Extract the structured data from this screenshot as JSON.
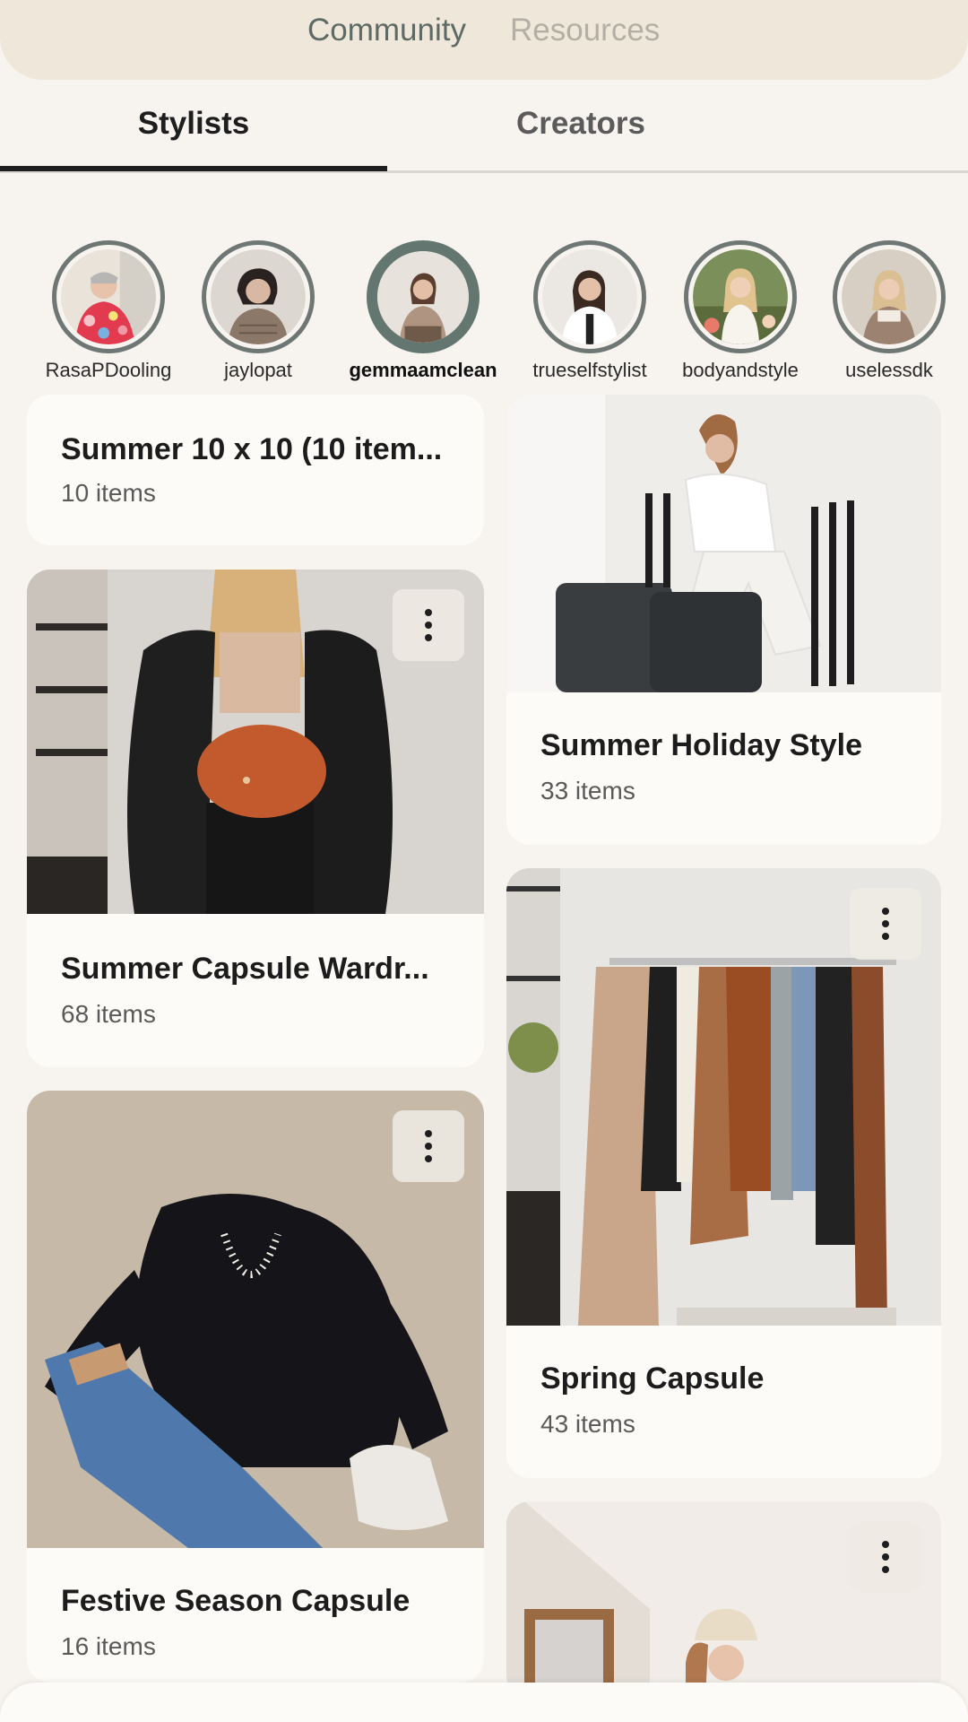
{
  "header": {
    "tabs": [
      {
        "label": "Community",
        "active": true
      },
      {
        "label": "Resources",
        "active": false
      }
    ]
  },
  "sub_tabs": [
    {
      "label": "Stylists",
      "active": true
    },
    {
      "label": "Creators",
      "active": false
    }
  ],
  "stylists": [
    {
      "name": "RasaPDooling",
      "selected": false
    },
    {
      "name": "jaylopat",
      "selected": false
    },
    {
      "name": "gemmaamclean",
      "selected": true
    },
    {
      "name": "trueselfstylist",
      "selected": false
    },
    {
      "name": "bodyandstyle",
      "selected": false
    },
    {
      "name": "uselessdk",
      "selected": false
    }
  ],
  "cards": [
    {
      "title": "Summer 10 x 10 (10 item...",
      "count": "10 items",
      "image": "outfit-photo"
    },
    {
      "title": "Summer Holiday Style",
      "count": "33 items",
      "image": "woman-on-suitcase-photo"
    },
    {
      "title": "Summer Capsule Wardr...",
      "count": "68 items",
      "image": "black-shirt-orange-bag-photo"
    },
    {
      "title": "Spring Capsule",
      "count": "43 items",
      "image": "clothes-rack-photo"
    },
    {
      "title": "Festive Season Capsule",
      "count": "16 items",
      "image": "velvet-jacket-jeans-flatlay-photo"
    },
    {
      "title": "",
      "count": "",
      "image": "woman-in-beanie-photo"
    }
  ],
  "colors": {
    "background": "#f7f3ee",
    "header": "#efe7d9",
    "accent": "#637770",
    "card": "#fdfbf8"
  }
}
